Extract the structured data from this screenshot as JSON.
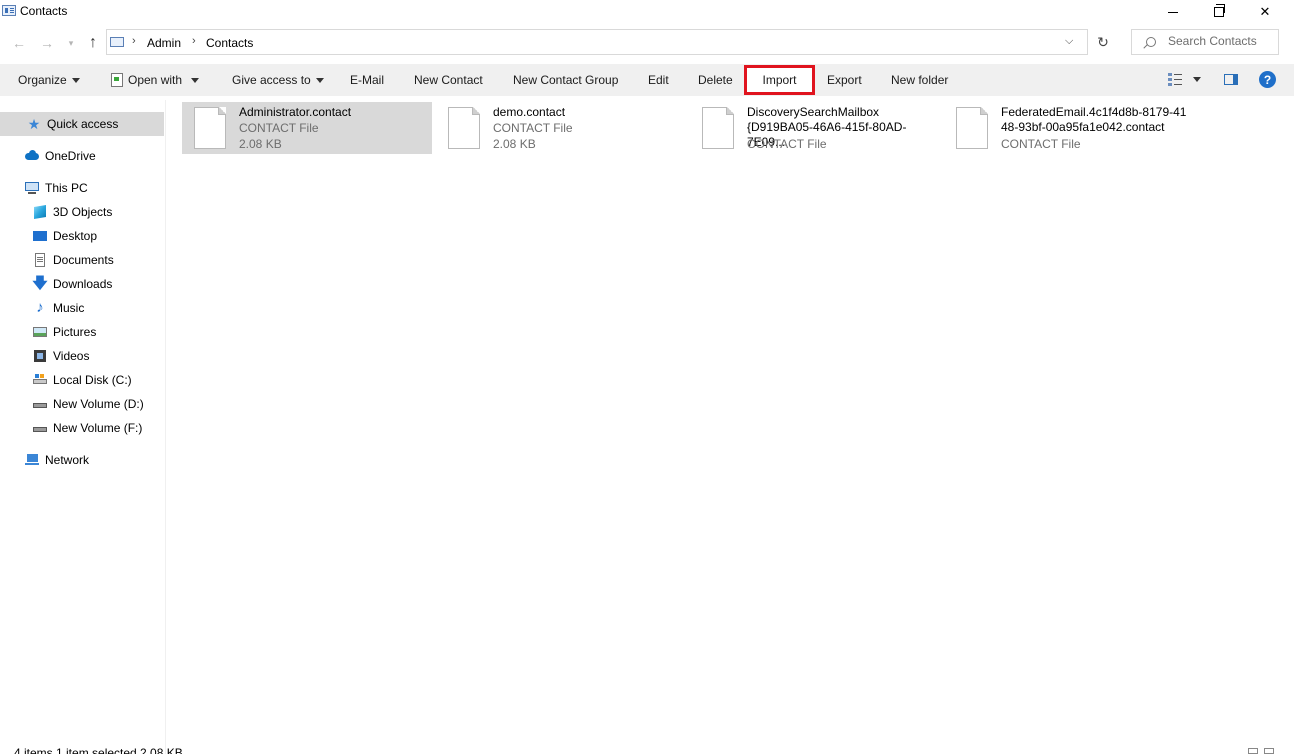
{
  "window": {
    "title": "Contacts",
    "controls": {
      "minimize": "minimize",
      "maximize": "restore",
      "close": "✕"
    }
  },
  "address": {
    "breadcrumbs": [
      "Admin",
      "Contacts"
    ],
    "search_placeholder": "Search Contacts"
  },
  "toolbar": {
    "items": [
      {
        "label": "Organize",
        "dropdown": true
      },
      {
        "label": "Open with",
        "dropdown": true
      },
      {
        "label": "Give access to",
        "dropdown": true
      },
      {
        "label": "E-Mail"
      },
      {
        "label": "New Contact"
      },
      {
        "label": "New Contact Group"
      },
      {
        "label": "Edit"
      },
      {
        "label": "Delete"
      },
      {
        "label": "Import",
        "highlighted": true
      },
      {
        "label": "Export"
      },
      {
        "label": "New folder"
      }
    ],
    "help_label": "?",
    "highlight_color": "#e0141e"
  },
  "sidebar": {
    "items": [
      {
        "label": "Quick access",
        "icon": "star-icon",
        "selected": true
      },
      {
        "label": "OneDrive",
        "icon": "cloud-icon"
      },
      {
        "label": "This PC",
        "icon": "computer-icon"
      },
      {
        "label": "3D Objects",
        "icon": "cube-icon"
      },
      {
        "label": "Desktop",
        "icon": "desktop-icon"
      },
      {
        "label": "Documents",
        "icon": "document-icon"
      },
      {
        "label": "Downloads",
        "icon": "download-arrow-icon"
      },
      {
        "label": "Music",
        "icon": "music-note-icon"
      },
      {
        "label": "Pictures",
        "icon": "picture-icon"
      },
      {
        "label": "Videos",
        "icon": "film-icon"
      },
      {
        "label": "Local Disk (C:)",
        "icon": "disk-drive-icon"
      },
      {
        "label": "New Volume (D:)",
        "icon": "drive-icon"
      },
      {
        "label": "New Volume (F:)",
        "icon": "drive-icon"
      },
      {
        "label": "Network",
        "icon": "network-icon"
      }
    ]
  },
  "files": [
    {
      "name": "Administrator.contact",
      "type": "CONTACT File",
      "size": "2.08 KB",
      "selected": true
    },
    {
      "name": "demo.contact",
      "type": "CONTACT File",
      "size": "2.08 KB"
    },
    {
      "name": "DiscoverySearchMailbox {D919BA05-46A6-415f-80AD-7E09...",
      "type": "CONTACT File"
    },
    {
      "name": "FederatedEmail.4c1f4d8b-8179-4148-93bf-00a95fa1e042.contact",
      "type": "CONTACT File"
    }
  ],
  "status": {
    "text": "4 items    1 item selected  2.08 KB"
  },
  "colors": {
    "selection": "#d9d9d9",
    "command_bar": "#f0f0f0",
    "accent": "#1f6fc9"
  }
}
